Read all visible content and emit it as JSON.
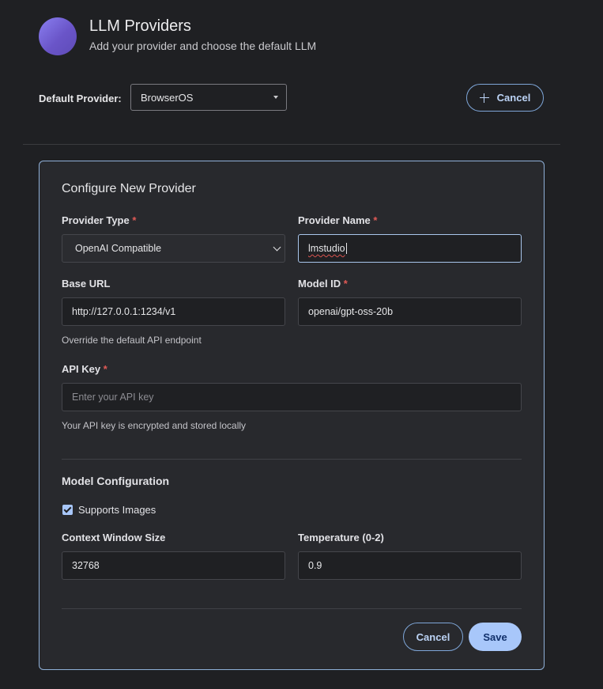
{
  "header": {
    "title": "LLM Providers",
    "subtitle": "Add your provider and choose the default LLM"
  },
  "default_provider": {
    "label": "Default Provider:",
    "selected": "BrowserOS"
  },
  "top_actions": {
    "cancel_label": "Cancel",
    "cancel_icon": "plus-icon"
  },
  "form": {
    "title": "Configure New Provider",
    "provider_type": {
      "label": "Provider Type",
      "required_mark": "*",
      "value": "OpenAI Compatible"
    },
    "provider_name": {
      "label": "Provider Name",
      "required_mark": "*",
      "value": "lmstudio"
    },
    "base_url": {
      "label": "Base URL",
      "value": "http://127.0.0.1:1234/v1",
      "help": "Override the default API endpoint"
    },
    "model_id": {
      "label": "Model ID",
      "required_mark": "*",
      "value": "openai/gpt-oss-20b"
    },
    "api_key": {
      "label": "API Key",
      "required_mark": "*",
      "placeholder": "Enter your API key",
      "value": "",
      "help": "Your API key is encrypted and stored locally"
    },
    "model_config": {
      "title": "Model Configuration",
      "supports_images": {
        "label": "Supports Images",
        "checked": true
      },
      "context_window": {
        "label": "Context Window Size",
        "value": "32768"
      },
      "temperature": {
        "label": "Temperature (0-2)",
        "value": "0.9"
      }
    },
    "actions": {
      "cancel_label": "Cancel",
      "save_label": "Save"
    }
  },
  "colors": {
    "background": "#1f2023",
    "card": "#28292d",
    "accent": "#a8c7fa",
    "required": "#e05a56"
  }
}
